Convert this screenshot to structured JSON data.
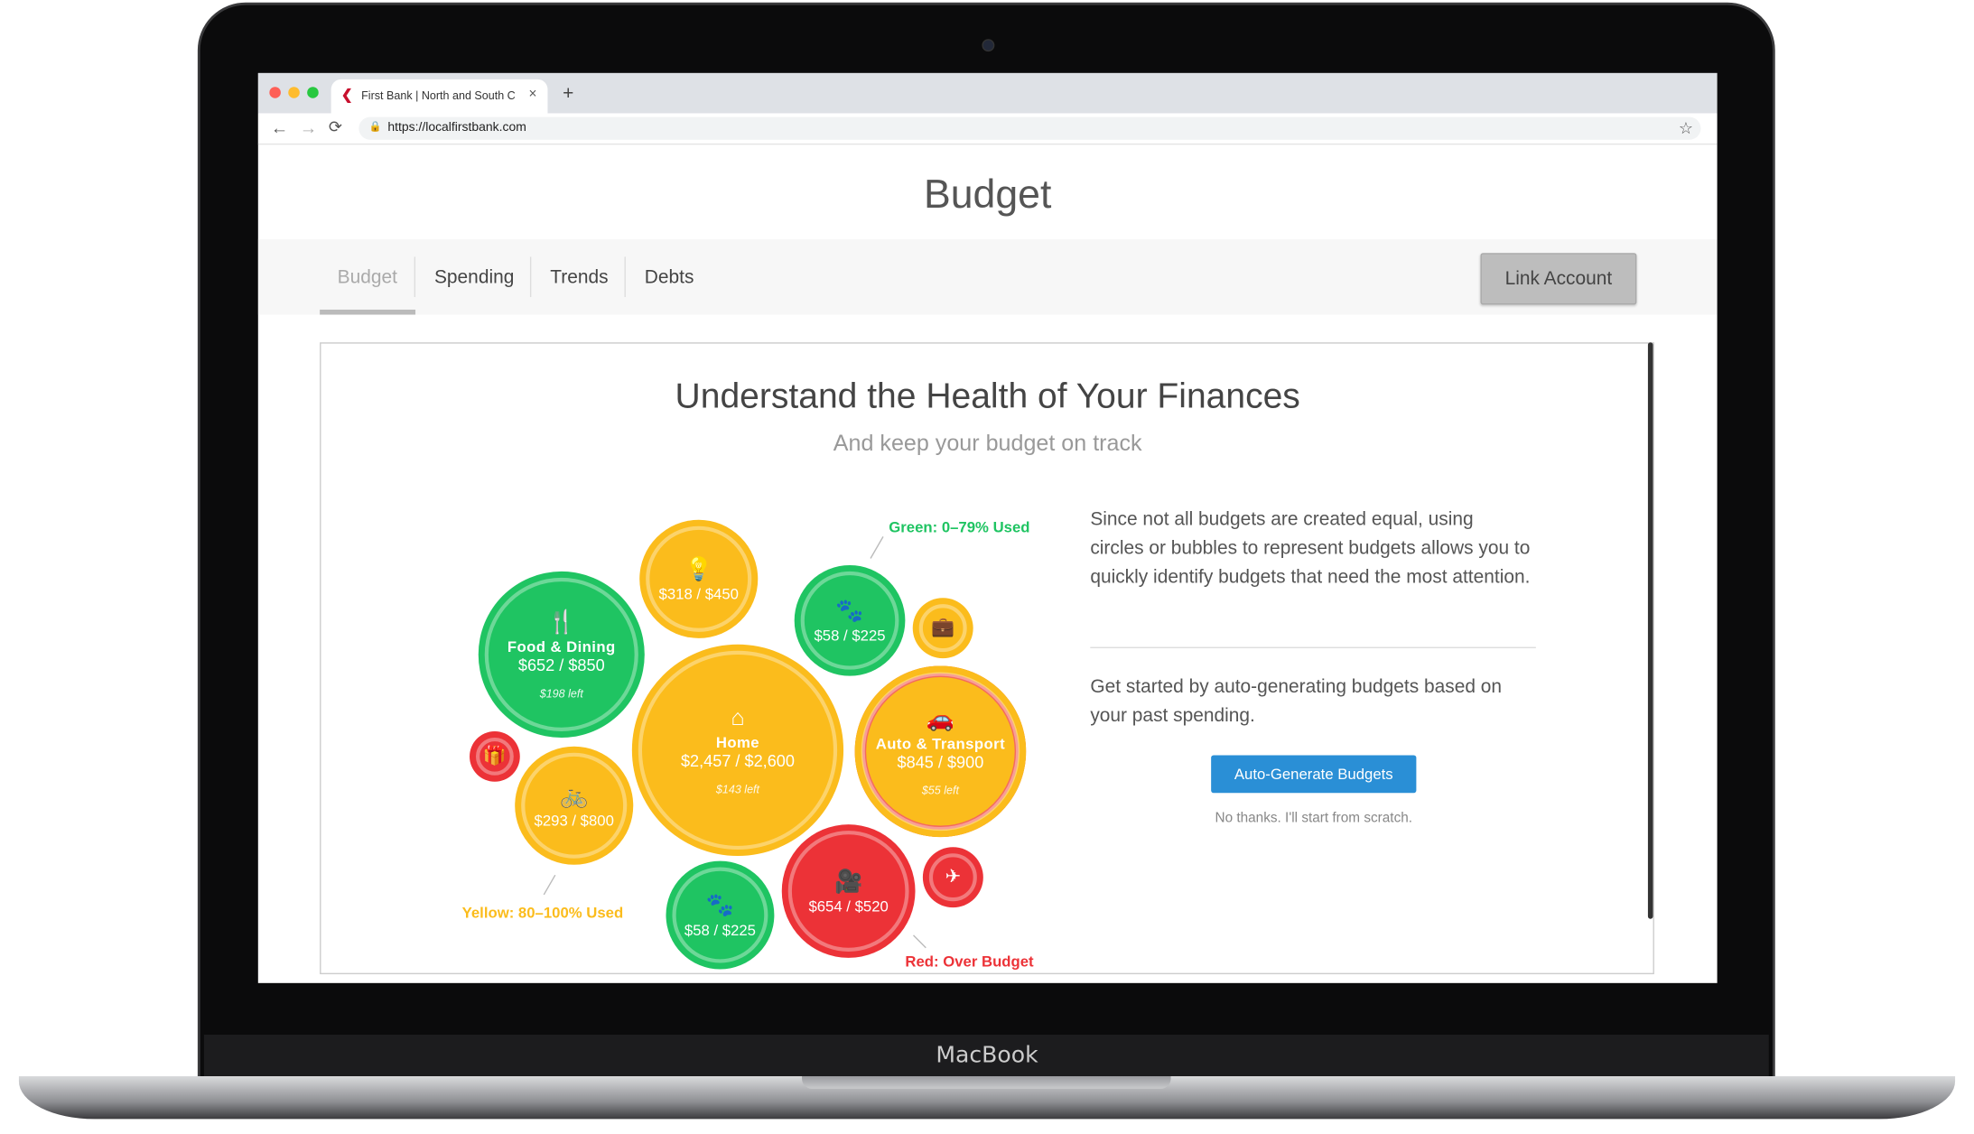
{
  "device": {
    "label": "MacBook"
  },
  "browser": {
    "tab_title": "First Bank | North and South C",
    "tab_close": "×",
    "new_tab": "+",
    "url": "https://localfirstbank.com",
    "back": "←",
    "forward": "→",
    "reload": "⟳",
    "star": "☆"
  },
  "page": {
    "title": "Budget"
  },
  "nav": {
    "tabs": [
      {
        "label": "Budget",
        "active": true
      },
      {
        "label": "Spending"
      },
      {
        "label": "Trends"
      },
      {
        "label": "Debts"
      }
    ],
    "link_account": "Link Account"
  },
  "card": {
    "heading": "Understand the Health of Your Finances",
    "subheading": "And keep your budget on track"
  },
  "colors": {
    "green": "#1fc462",
    "yellow": "#fbbc1c",
    "red": "#ec3237",
    "blue": "#2a8fd6"
  },
  "bubbles": [
    {
      "icon": "fork-knife-icon",
      "glyph": "🍴",
      "label": "Food & Dining",
      "amount": "$652 / $850",
      "left": "$198 left",
      "status": "green"
    },
    {
      "icon": "lightbulb-icon",
      "glyph": "💡",
      "amount": "$318 / $450",
      "status": "yellow"
    },
    {
      "icon": "paw-icon",
      "glyph": "🐾",
      "amount": "$58 / $225",
      "status": "green"
    },
    {
      "icon": "briefcase-icon",
      "glyph": "💼",
      "status": "yellow"
    },
    {
      "icon": "home-icon",
      "glyph": "⌂",
      "label": "Home",
      "amount": "$2,457 / $2,600",
      "left": "$143 left",
      "status": "yellow"
    },
    {
      "icon": "car-icon",
      "glyph": "🚗",
      "label": "Auto & Transport",
      "amount": "$845 / $900",
      "left": "$55 left",
      "status": "yellow"
    },
    {
      "icon": "gift-icon",
      "glyph": "🎁",
      "status": "red"
    },
    {
      "icon": "bicycle-icon",
      "glyph": "🚲",
      "amount": "$293 / $800",
      "status": "yellow"
    },
    {
      "icon": "paw-icon",
      "glyph": "🐾",
      "amount": "$58 / $225",
      "status": "green"
    },
    {
      "icon": "movie-camera-icon",
      "glyph": "🎥",
      "amount": "$654 / $520",
      "status": "red"
    },
    {
      "icon": "airplane-icon",
      "glyph": "✈",
      "status": "red"
    }
  ],
  "legend": {
    "green": "Green: 0–79% Used",
    "yellow": "Yellow: 80–100% Used",
    "red": "Red: Over Budget"
  },
  "info": {
    "para1": "Since not all budgets are created equal, using circles or bubbles to represent budgets allows you to quickly identify budgets that need the most attention.",
    "para2": "Get started by auto-generating budgets based on your past spending.",
    "auto_button": "Auto-Generate Budgets",
    "no_thanks": "No thanks. I'll start from scratch."
  }
}
